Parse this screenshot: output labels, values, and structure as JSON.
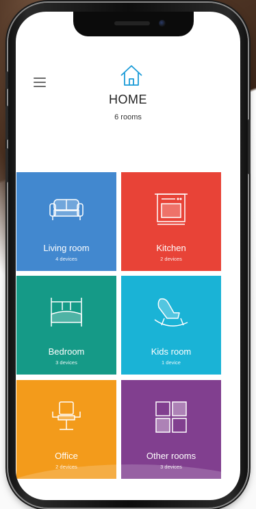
{
  "header": {
    "menu_icon": "hamburger-menu-icon",
    "home_icon": "house-icon",
    "title": "HOME",
    "subtitle": "6 rooms"
  },
  "rooms": [
    {
      "name": "Living room",
      "devices": "4 devices",
      "color": "#4288cf",
      "icon": "sofa-icon"
    },
    {
      "name": "Kitchen",
      "devices": "2 devices",
      "color": "#e84337",
      "icon": "oven-icon"
    },
    {
      "name": "Bedroom",
      "devices": "3 devices",
      "color": "#159a87",
      "icon": "bed-icon"
    },
    {
      "name": "Kids room",
      "devices": "1 device",
      "color": "#1ab3d6",
      "icon": "rocking-horse-icon"
    },
    {
      "name": "Office",
      "devices": "2 devices",
      "color": "#f39b1b",
      "icon": "office-chair-icon"
    },
    {
      "name": "Other rooms",
      "devices": "3 devices",
      "color": "#813f8f",
      "icon": "grid-squares-icon"
    }
  ],
  "colors": {
    "accent": "#1a9bd7"
  }
}
